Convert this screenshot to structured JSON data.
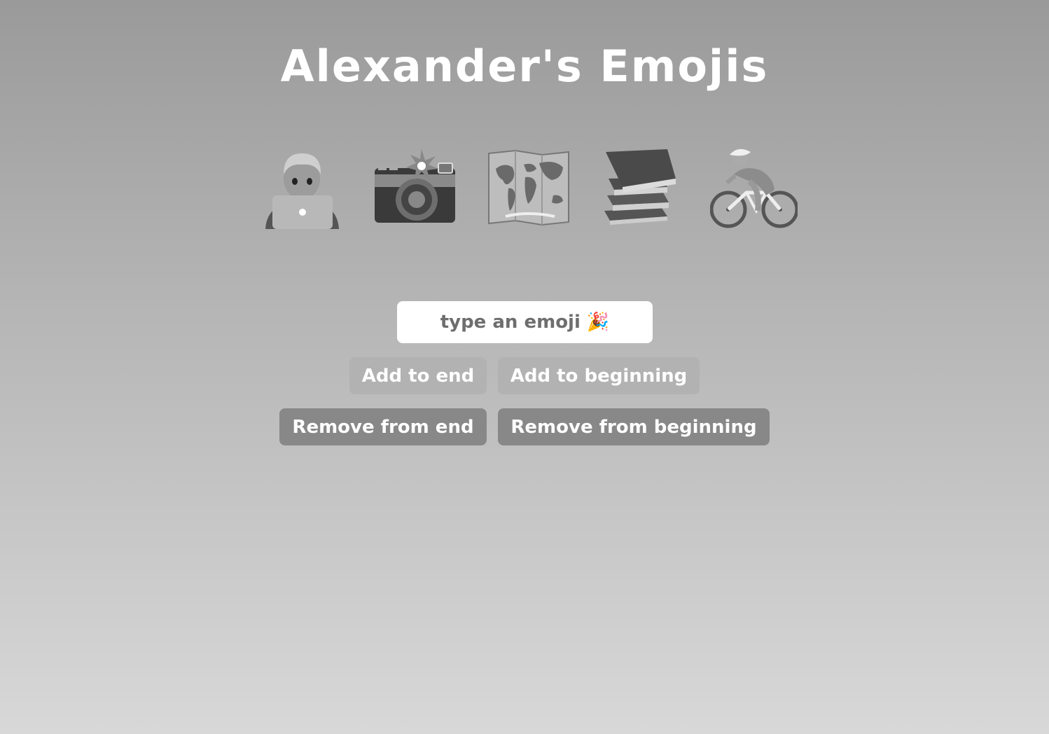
{
  "header": {
    "title": "Alexander's Emojis"
  },
  "emojis": [
    {
      "icon": "technologist-icon"
    },
    {
      "icon": "camera-with-flash-icon"
    },
    {
      "icon": "world-map-icon"
    },
    {
      "icon": "books-icon"
    },
    {
      "icon": "person-biking-icon"
    }
  ],
  "emoji_input": {
    "value": "",
    "placeholder": "type an emoji 🎉"
  },
  "buttons": {
    "add_end": "Add to end",
    "add_beginning": "Add to beginning",
    "remove_end": "Remove from end",
    "remove_beginning": "Remove from beginning"
  },
  "colors": {
    "background_top": "#9a9a9a",
    "background_bottom": "#d8d8d8",
    "add_button": "#b2b2b2",
    "remove_button": "#888888",
    "text": "#ffffff"
  }
}
